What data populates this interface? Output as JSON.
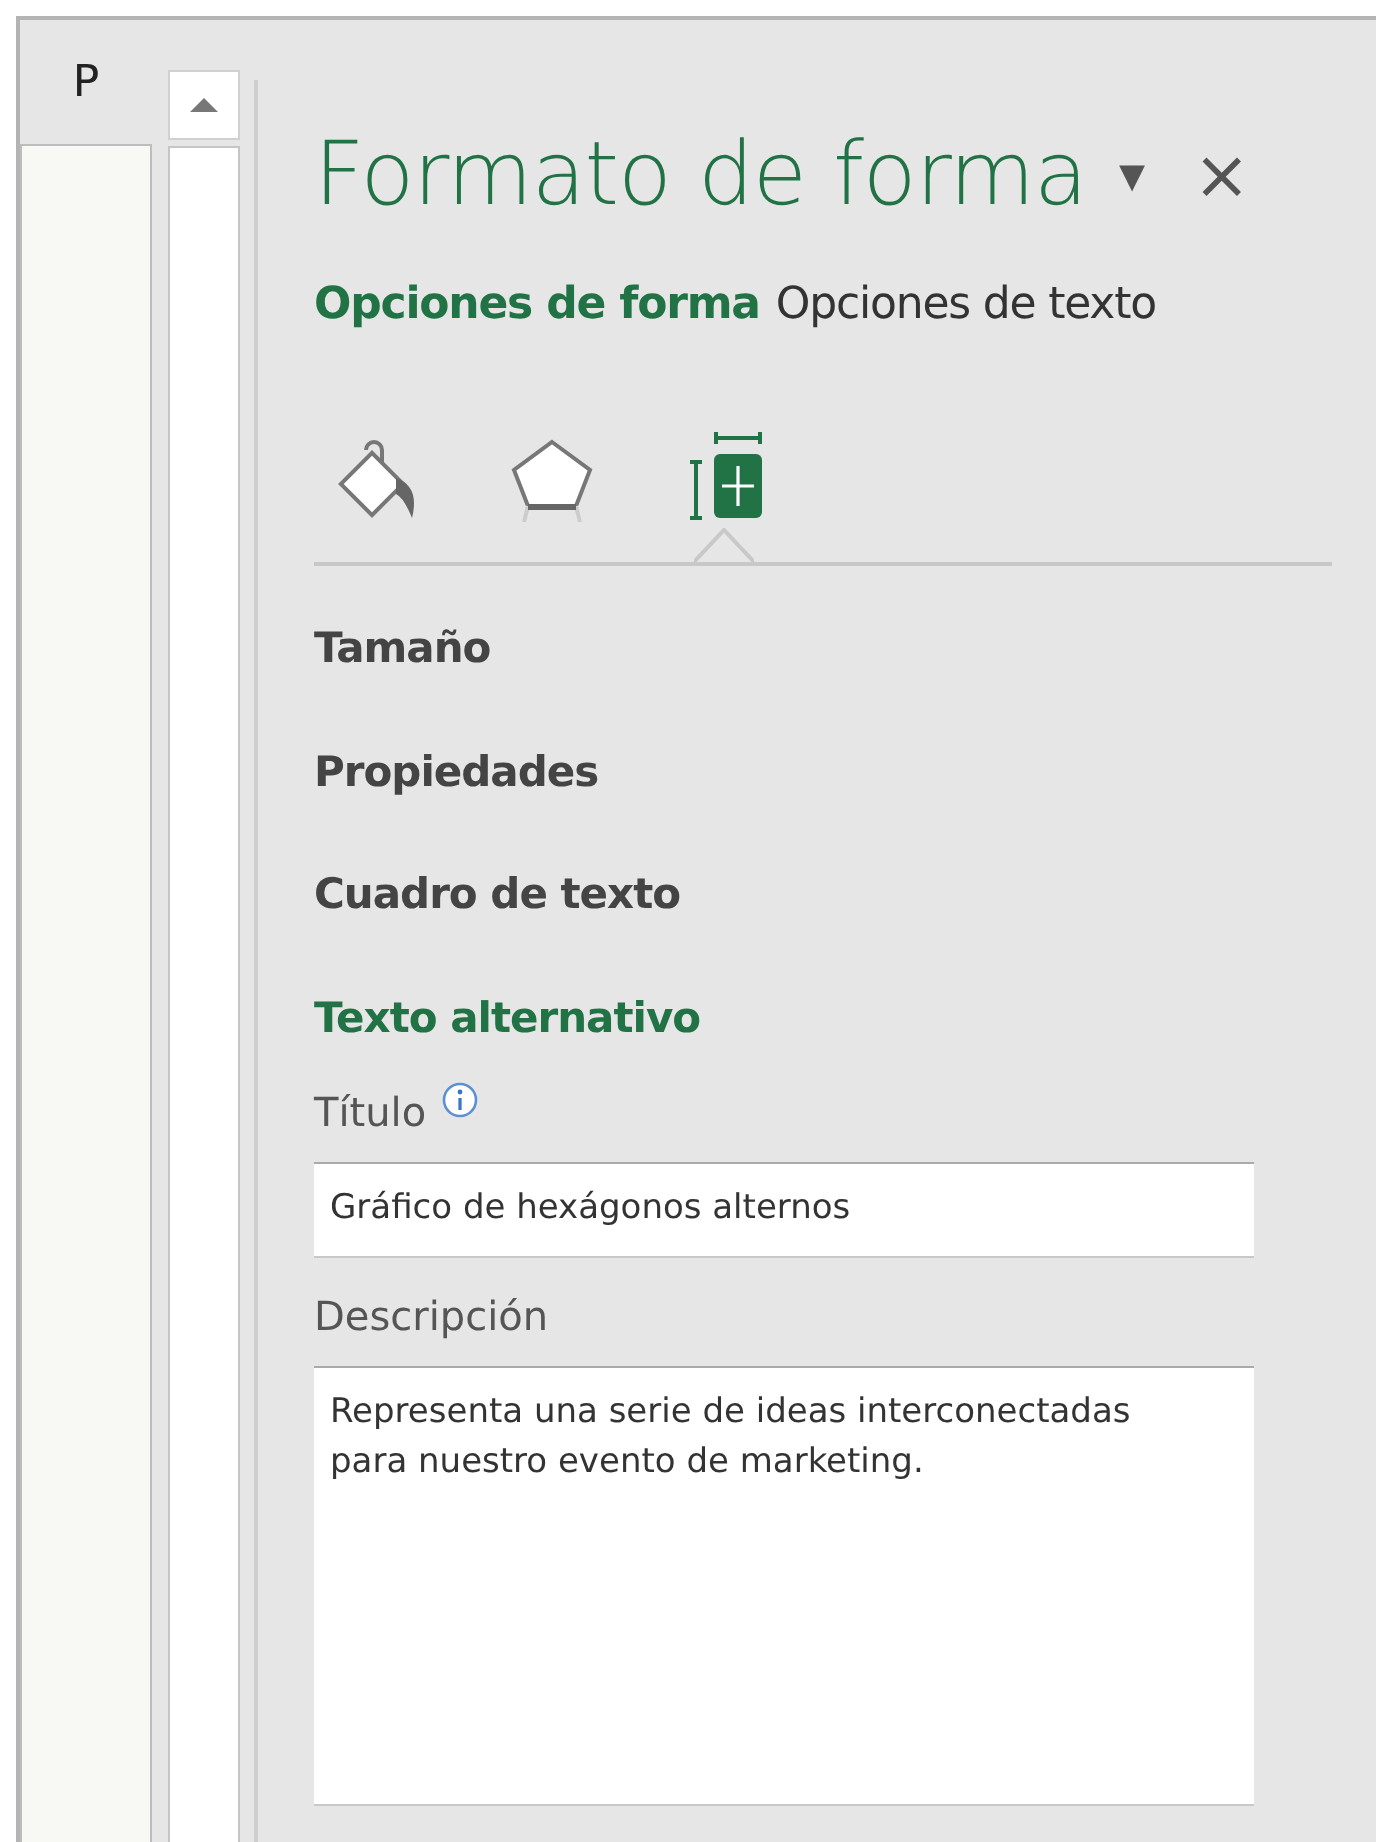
{
  "sheet": {
    "column_header": "P"
  },
  "panel": {
    "title": "Formato de forma",
    "menu_glyph": "▾",
    "close_glyph": "×",
    "tabs": [
      {
        "label": "Opciones de forma",
        "selected": true
      },
      {
        "label": "Opciones de texto",
        "selected": false
      }
    ],
    "icon_tabs": [
      {
        "kind": "fill",
        "selected": false
      },
      {
        "kind": "effects",
        "selected": false
      },
      {
        "kind": "size",
        "selected": true
      }
    ],
    "sections": [
      {
        "label": "Tamaño",
        "expanded": false
      },
      {
        "label": "Propiedades",
        "expanded": false
      },
      {
        "label": "Cuadro de texto",
        "expanded": false
      },
      {
        "label": "Texto alternativo",
        "expanded": true
      }
    ],
    "fields": [
      {
        "kind": "line",
        "label": "Título",
        "info": true,
        "value": "Gráfico de hexágonos alternos"
      },
      {
        "kind": "area",
        "label": "Descripción",
        "info": false,
        "value": "Representa una serie de ideas interconectadas para nuestro evento de marketing."
      }
    ]
  }
}
